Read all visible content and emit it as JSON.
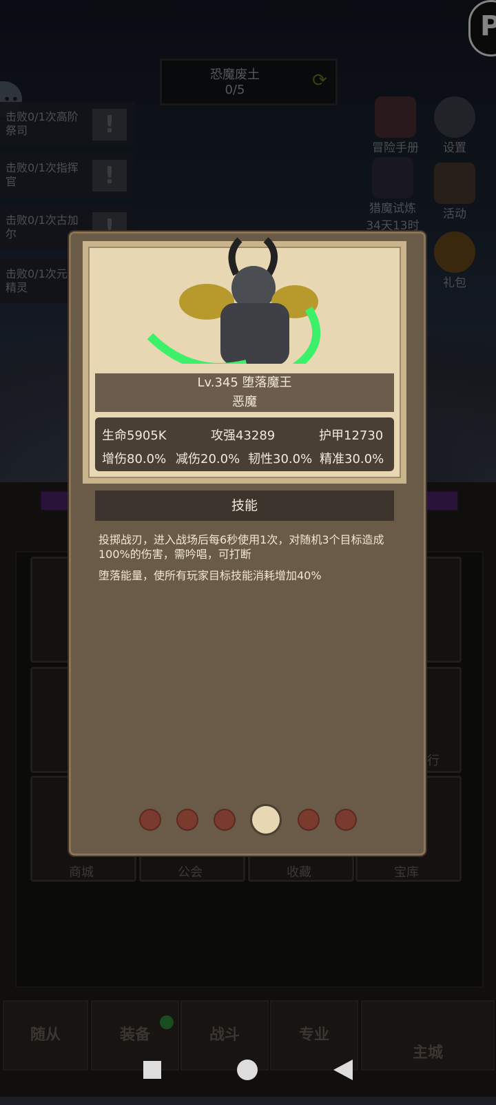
{
  "quest": {
    "title": "恐魔废土",
    "progress": "0/5"
  },
  "tasks": [
    {
      "label": "击败0/1次高阶祭司"
    },
    {
      "label": "击败0/1次指挥官"
    },
    {
      "label": "击败0/1次古加尔"
    },
    {
      "label": "击败0/1次元素精灵"
    }
  ],
  "side_menu": {
    "adventure_book": "冒险手册",
    "settings": "设置",
    "hunt_trial": "猎魔试炼",
    "hunt_timer": "34天13时",
    "activity": "活动",
    "gift": "礼包"
  },
  "grid_labels": {
    "shop": "商城",
    "guild": "公会",
    "collection": "收藏",
    "vault": "宝库",
    "partial": "行"
  },
  "nav": {
    "followers": "随从",
    "equipment": "装备",
    "battle": "战斗",
    "profession": "专业",
    "main_city": "主城"
  },
  "monster": {
    "level_name": "Lv.345 堕落魔王",
    "type": "恶魔",
    "stats": {
      "hp": "生命5905K",
      "attack": "攻强43289",
      "armor": "护甲12730",
      "dmg_up": "增伤80.0%",
      "dmg_down": "减伤20.0%",
      "toughness": "韧性30.0%",
      "precision": "精准30.0%"
    },
    "skill_header": "技能",
    "skill_1": "投掷战刃，进入战场后每6秒使用1次，对随机3个目标造成100%的伤害，需吟唱，可打断",
    "skill_2": "堕落能量，使所有玩家目标技能消耗增加40%"
  },
  "pagination": {
    "total": 6,
    "active_index": 3
  },
  "colors": {
    "accent_green": "#3df06a",
    "parchment": "#e7d7b2",
    "dot": "#7a3a2e"
  }
}
